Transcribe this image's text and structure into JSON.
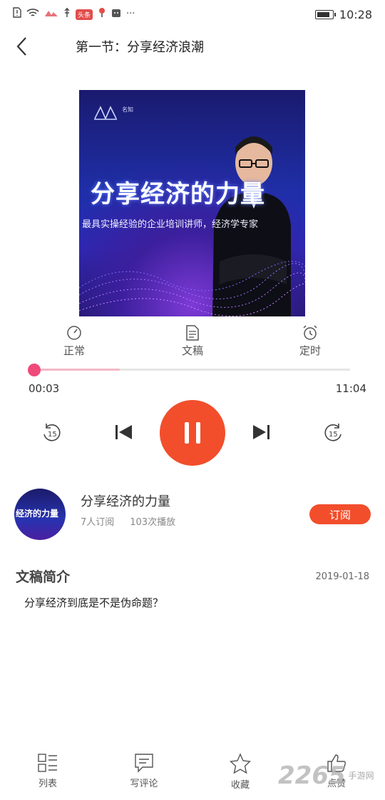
{
  "status_bar": {
    "badge": "头条",
    "time": "10:28",
    "battery_level": 0.9
  },
  "header": {
    "title": "第一节：分享经济浪潮"
  },
  "cover": {
    "brand": "名知",
    "title": "分享经济的力量",
    "subtitle": "最具实操经验的企业培训讲师，经济学专家"
  },
  "controls": {
    "speed_label": "正常",
    "script_label": "文稿",
    "timer_label": "定时"
  },
  "player": {
    "current_time": "00:03",
    "total_time": "11:04",
    "progress": 0.005,
    "buffered": 0.27,
    "rewind_seconds": "15",
    "forward_seconds": "15"
  },
  "album": {
    "avatar_text": "经济的力量",
    "name": "分享经济的力量",
    "subscribers": "7人订阅",
    "plays": "103次播放",
    "subscribe_label": "订阅"
  },
  "intro": {
    "title": "文稿简介",
    "date": "2019-01-18",
    "text": "分享经济到底是不是伪命题？"
  },
  "bottom_nav": {
    "list_label": "列表",
    "comment_label": "写评论",
    "favorite_label": "收藏",
    "like_label": "点赞"
  },
  "watermark": {
    "number": "2265",
    "suffix": "手游网"
  }
}
